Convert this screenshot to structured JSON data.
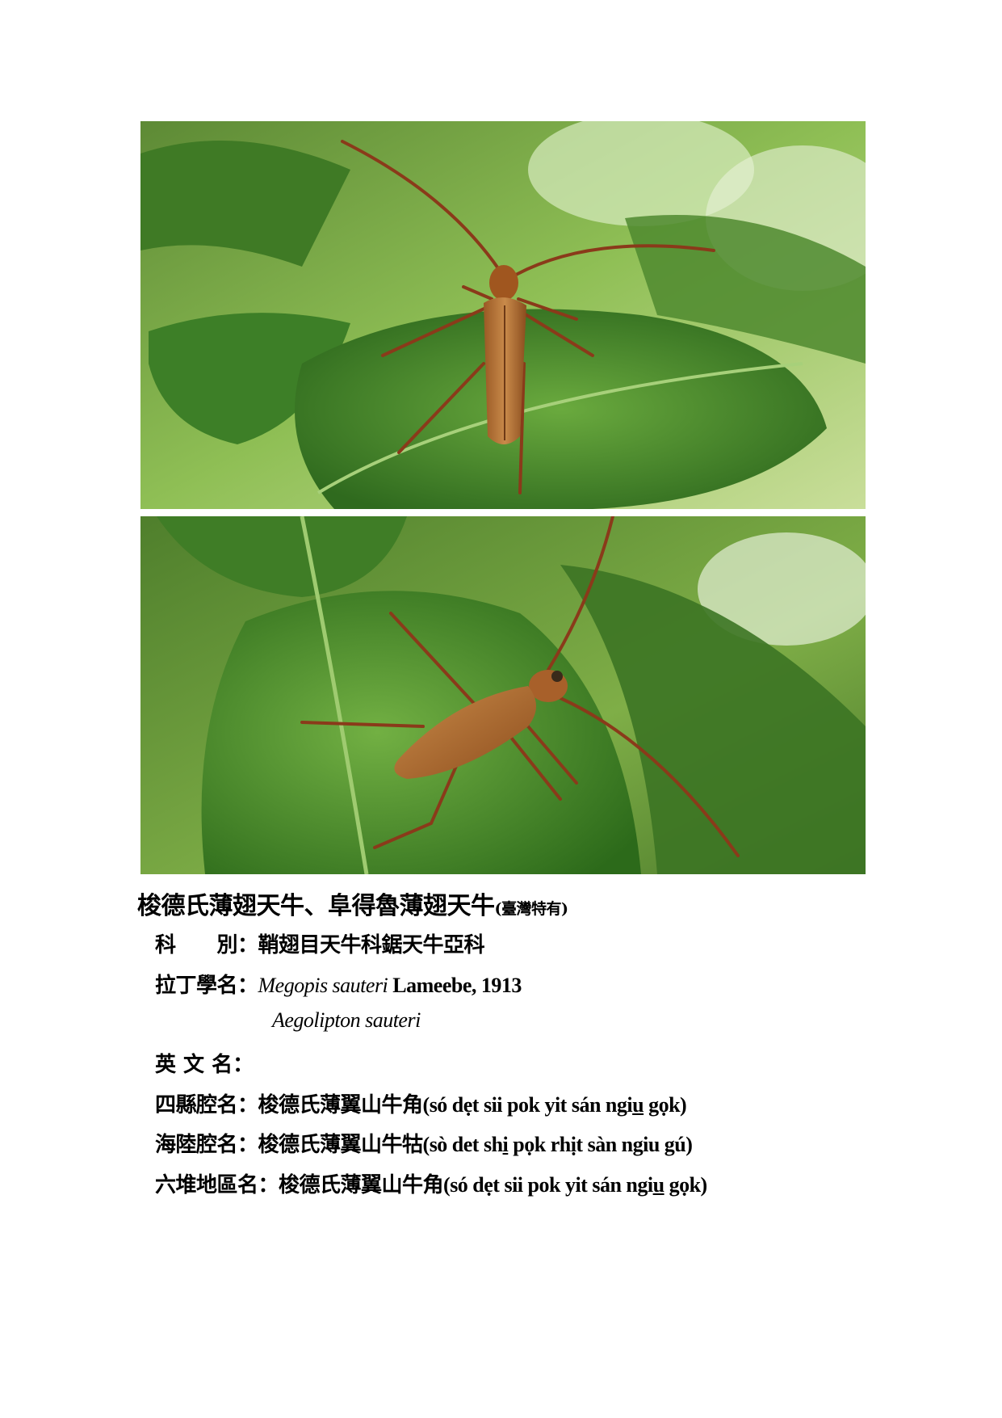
{
  "photos": [
    {
      "subject": "longhorn beetle on green leaf, top view"
    },
    {
      "subject": "longhorn beetle on green leaf, side view"
    }
  ],
  "title": {
    "main": "梭德氏薄翅天牛、阜得魯薄翅天牛",
    "note": "(臺灣特有)"
  },
  "family": {
    "label": "科　　別：",
    "value": "鞘翅目天牛科鋸天牛亞科"
  },
  "latin": {
    "label": "拉丁學名：",
    "genus_species": "Megopis sauteri",
    "author": " Lameebe, 1913",
    "synonym": "Aegolipton sauteri"
  },
  "english": {
    "label": "英 文 名："
  },
  "sixian": {
    "label": "四縣腔名：",
    "value": "梭德氏薄翼山牛角",
    "rom_a": "(só dẹt sii pok yit sán ngi",
    "rom_u": "u",
    "rom_b": " gọk)"
  },
  "hailu": {
    "label": "海陸腔名：",
    "value": "梭德氏薄翼山牛牯",
    "rom_a": "(sò det sh",
    "rom_u": "i",
    "rom_b": " pọk rhịt sàn ngiu gú)"
  },
  "liudui": {
    "label": "六堆地區名：",
    "value": "梭德氏薄翼山牛角",
    "rom_a": "(só dẹt sii pok yit sán ngi",
    "rom_u": "u",
    "rom_b": " gọk)"
  }
}
